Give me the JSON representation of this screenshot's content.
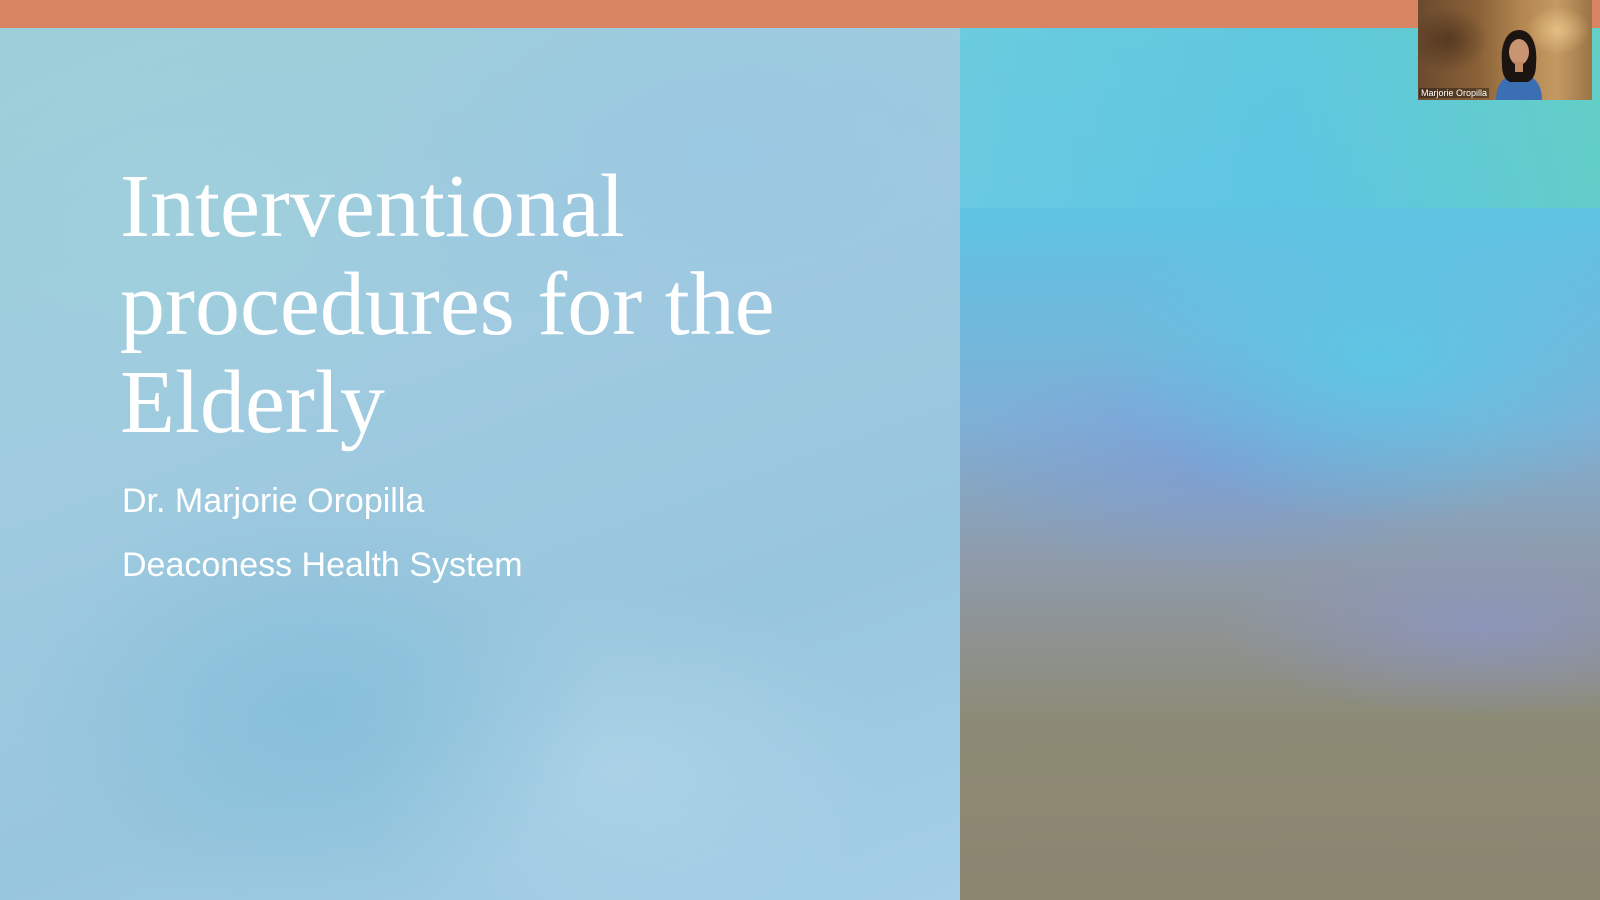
{
  "slide": {
    "title": "Interventional\nprocedures for the\nElderly",
    "presenter": "Dr. Marjorie Oropilla",
    "organization": "Deaconess Health System"
  },
  "video": {
    "participant_name": "Marjorie Oropilla"
  },
  "colors": {
    "top_bar": "#d98463",
    "slide_left": "#9fcae0",
    "title_text": "#ffffff"
  }
}
